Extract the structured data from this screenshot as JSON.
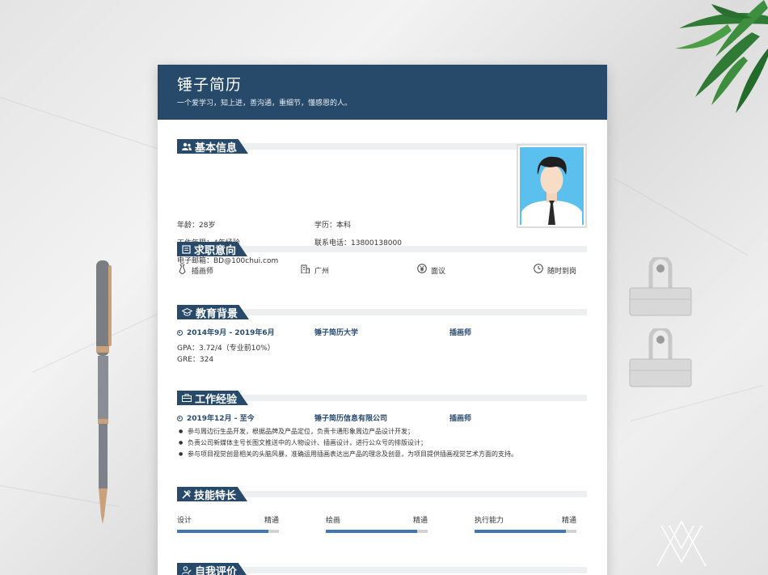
{
  "header": {
    "name": "锤子简历",
    "motto": "一个爱学习，知上进，善沟通，重细节，懂感恩的人。"
  },
  "basic": {
    "title": "基本信息",
    "age": "年龄：28岁",
    "education": "学历：本科",
    "work_years": "工作年限：4年经验",
    "phone": "联系电话：13800138000",
    "email": "电子邮箱：BD@100chui.com"
  },
  "intent": {
    "title": "求职意向",
    "position": "插画师",
    "city": "广州",
    "salary": "面议",
    "availability": "随时到岗"
  },
  "education": {
    "title": "教育背景",
    "period": "2014年9月 - 2019年6月",
    "school": "锤子简历大学",
    "major": "插画师",
    "gpa": "GPA：3.72/4（专业前10%）",
    "gre": "GRE：324"
  },
  "work": {
    "title": "工作经验",
    "period": "2019年12月 - 至今",
    "company": "锤子简历信息有限公司",
    "role": "插画师",
    "items": [
      "参与周边衍生品开发，根据品牌及产品定位，负责卡通形象周边产品设计开发；",
      "负责公司新媒体主号长图文推送中的人物设计、插画设计，进行公众号的排版设计；",
      "参与项目视觉创意相关的头脑风暴，准确运用插画表达出产品的理念及创意，为项目提供插画视觉艺术方面的支持。"
    ]
  },
  "skills": {
    "title": "技能特长",
    "list": [
      {
        "name": "设计",
        "level": "精通",
        "percent": 90
      },
      {
        "name": "绘画",
        "level": "精通",
        "percent": 90
      },
      {
        "name": "执行能力",
        "level": "精通",
        "percent": 90
      }
    ]
  },
  "self": {
    "title": "自我评价"
  },
  "colors": {
    "primary": "#274a6b",
    "skill_bar": "#3f78b6",
    "photo_bg": "#5cc0ee"
  }
}
